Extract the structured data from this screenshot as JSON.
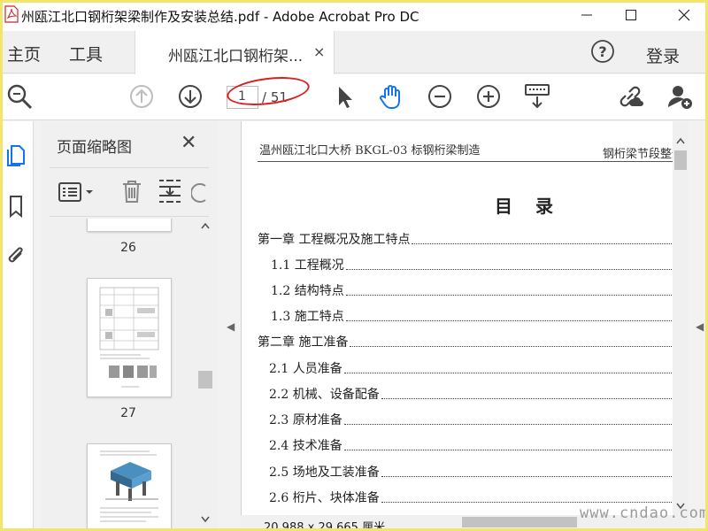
{
  "window": {
    "title": "州瓯江北口钢桁架梁制作及安装总结.pdf - Adobe Acrobat Pro DC",
    "minimize_label": "—",
    "maximize_label": "☐",
    "close_label": "✕"
  },
  "tabs": {
    "home_label": "主页",
    "tools_label": "工具",
    "document_label": "州瓯江北口钢桁架...",
    "document_close": "×",
    "sign_in_label": "登录"
  },
  "toolbar": {
    "current_page": "1",
    "total_pages": "/ 51",
    "icons": [
      "zoom-search-icon",
      "previous-page-icon",
      "next-page-icon",
      "select-cursor-icon",
      "hand-tool-icon",
      "zoom-out-icon",
      "zoom-in-icon",
      "keyboard-scroll-icon",
      "share-link-icon",
      "add-user-icon"
    ]
  },
  "left_rail": {
    "icons": [
      "page-thumbnails-icon",
      "bookmarks-icon",
      "attachments-icon"
    ]
  },
  "thumbnail_pane": {
    "title": "页面缩略图",
    "close_label": "✕",
    "pages": [
      {
        "number": "26"
      },
      {
        "number": "27"
      }
    ]
  },
  "document": {
    "header_left": "温州瓯江北口大桥 BKGL-03 标钢桁梁制造",
    "header_right": "钢桁梁节段整体",
    "heading": "目录",
    "toc": [
      {
        "label": "第一章  工程概况及施工特点"
      },
      {
        "label": "1.1 工程概况"
      },
      {
        "label": "1.2  结构特点"
      },
      {
        "label": "1.3  施工特点"
      },
      {
        "label": "第二章  施工准备"
      },
      {
        "label": "2.1 人员准备"
      },
      {
        "label": "2.2  机械、设备配备"
      },
      {
        "label": "2.3 原材准备"
      },
      {
        "label": "2.4 技术准备"
      },
      {
        "label": "2.5 场地及工装准备"
      },
      {
        "label": "2.6  桁片、块体准备"
      }
    ]
  },
  "status": {
    "page_size": "20.988 x 29.665 厘米"
  },
  "watermark": "www.cndao.com",
  "colors": {
    "accent_blue": "#1473e6",
    "annotation_red": "#d9201f",
    "frame_yellow": "#f2e56a"
  }
}
